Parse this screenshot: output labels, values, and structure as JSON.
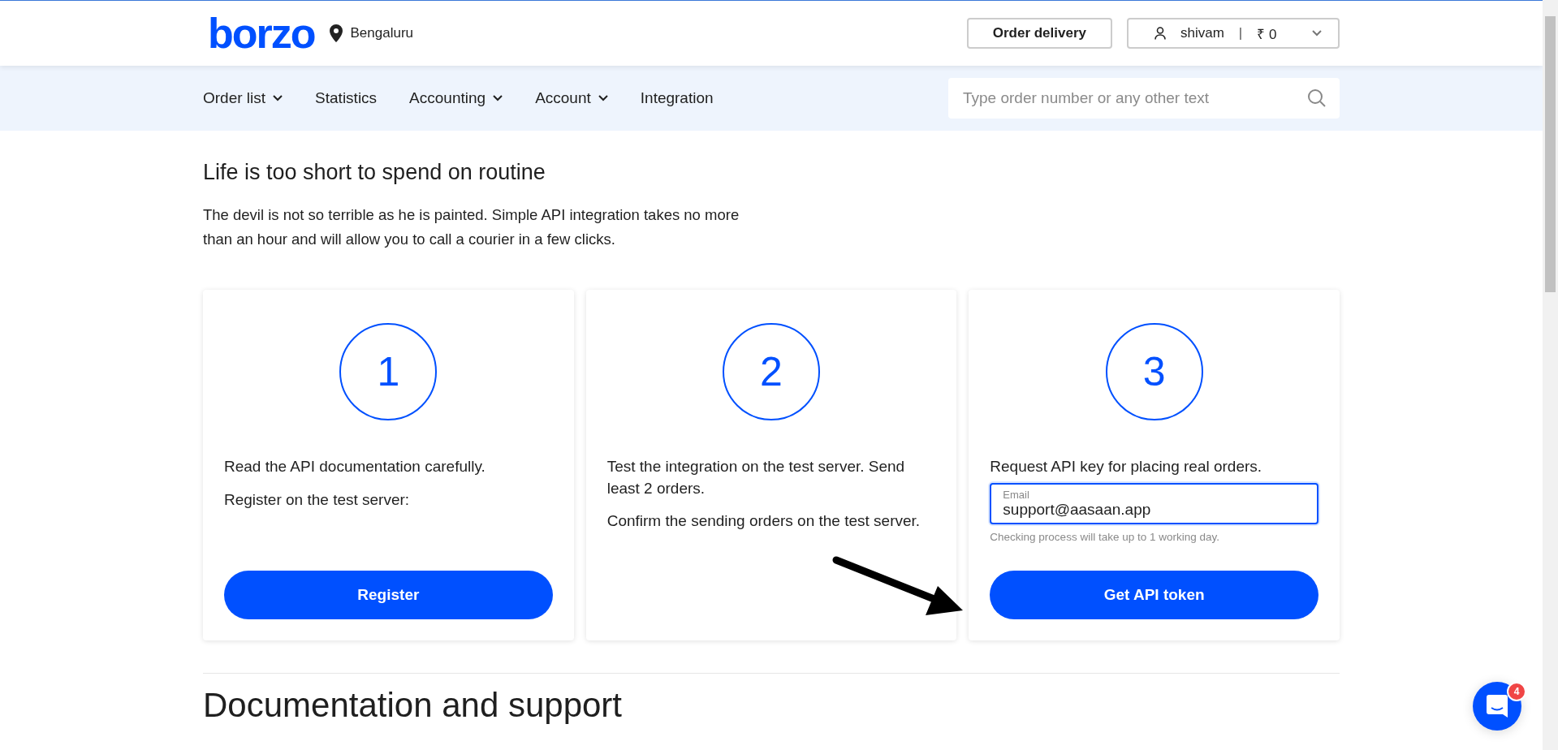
{
  "header": {
    "logo": "borzo",
    "city": "Bengaluru",
    "order_button": "Order delivery",
    "user": {
      "name": "shivam",
      "separator": "|",
      "balance": "₹ 0"
    }
  },
  "nav": {
    "items": [
      {
        "label": "Order list",
        "has_dropdown": true
      },
      {
        "label": "Statistics",
        "has_dropdown": false
      },
      {
        "label": "Accounting",
        "has_dropdown": true
      },
      {
        "label": "Account",
        "has_dropdown": true
      },
      {
        "label": "Integration",
        "has_dropdown": false
      }
    ],
    "search": {
      "placeholder": "Type order number or any other text"
    }
  },
  "intro": {
    "title": "Life is too short to spend on routine",
    "text": "The devil is not so terrible as he is painted. Simple API integration takes no more than an hour and will allow you to call a courier in a few clicks."
  },
  "steps": [
    {
      "number": "1",
      "kind": "register",
      "paragraphs": [
        "Read the API documentation carefully.",
        "Register on the test server:"
      ],
      "button": "Register"
    },
    {
      "number": "2",
      "kind": "test",
      "paragraphs": [
        "Test the integration on the test server. Send least 2 orders.",
        "Confirm the sending orders on the test server."
      ]
    },
    {
      "number": "3",
      "kind": "request",
      "paragraphs": [
        "Request API key for placing real orders."
      ],
      "email": {
        "label": "Email",
        "value": "support@aasaan.app",
        "hint": "Checking process will take up to 1 working day."
      },
      "button": "Get API token"
    }
  ],
  "section_title": "Documentation and support",
  "chat": {
    "badge": "4"
  }
}
